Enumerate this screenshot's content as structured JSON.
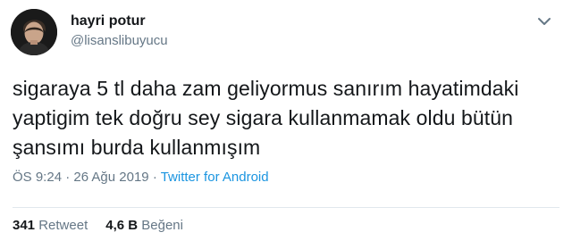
{
  "tweet": {
    "author": {
      "name": "hayri potur",
      "handle": "@lisanslibuyucu"
    },
    "text_lines": [
      "sigaraya 5 tl daha zam geliyormus sanırım hayatimdaki",
      "yaptigim tek doğru sey sigara kullanmamak oldu bütün",
      "şansımı burda kullanmışım"
    ],
    "time": "ÖS 9:24",
    "separator": " · ",
    "date": "26 Ağu 2019",
    "source": "Twitter for Android",
    "retweets": {
      "count": "341",
      "label": "Retweet"
    },
    "likes": {
      "count": "4,6 B",
      "label": "Beğeni"
    },
    "icons": {
      "more": "chevron-down-icon",
      "avatar": "avatar"
    },
    "colors": {
      "link": "#1b95e0",
      "secondary_text": "#657786",
      "primary_text": "#14171a"
    }
  }
}
